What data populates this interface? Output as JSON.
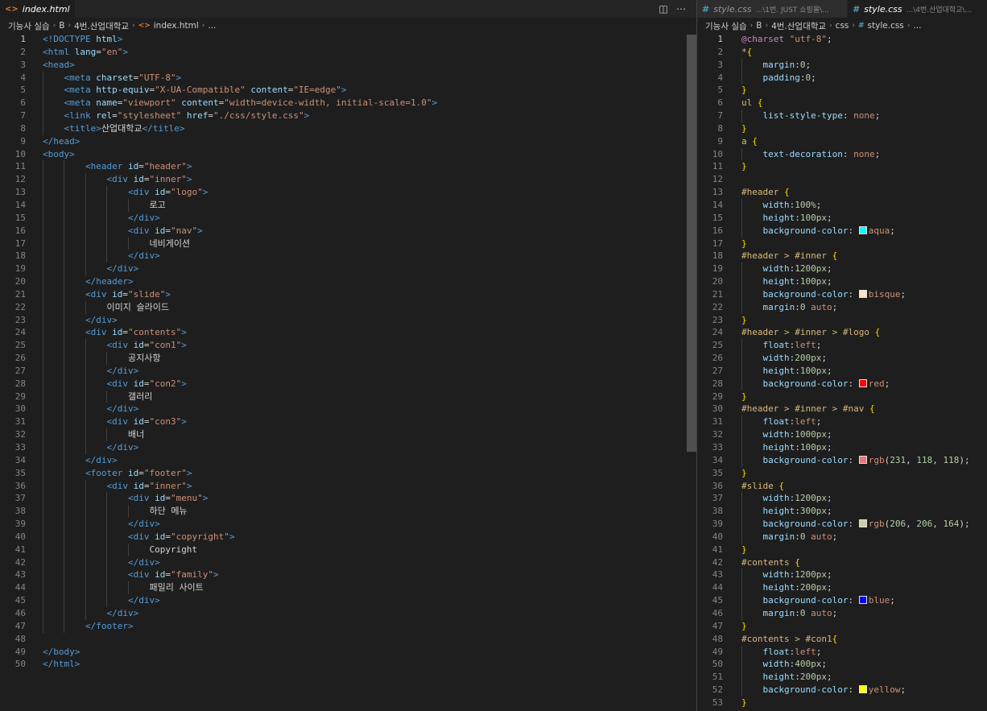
{
  "editor_left": {
    "tab": {
      "icon": "html-file-icon",
      "name": "index.html"
    },
    "breadcrumb": [
      "기능사 실습",
      "B",
      "4번.산업대학교",
      "index.html",
      "..."
    ],
    "lines": [
      [
        "<!DOCTYPE html>"
      ],
      [
        "<html lang=\"en\">"
      ],
      [
        "<head>"
      ],
      [
        "    <meta charset=\"UTF-8\">"
      ],
      [
        "    <meta http-equiv=\"X-UA-Compatible\" content=\"IE=edge\">"
      ],
      [
        "    <meta name=\"viewport\" content=\"width=device-width, initial-scale=1.0\">"
      ],
      [
        "    <link rel=\"stylesheet\" href=\"./css/style.css\">"
      ],
      [
        "    <title>산업대학교</title>"
      ],
      [
        "</head>"
      ],
      [
        "<body>"
      ],
      [
        "        <header id=\"header\">"
      ],
      [
        "            <div id=\"inner\">"
      ],
      [
        "                <div id=\"logo\">"
      ],
      [
        "                    로고"
      ],
      [
        "                </div>"
      ],
      [
        "                <div id=\"nav\">"
      ],
      [
        "                    네비게이션"
      ],
      [
        "                </div>"
      ],
      [
        "            </div>"
      ],
      [
        "        </header>"
      ],
      [
        "        <div id=\"slide\">"
      ],
      [
        "            이미지 슬라이드"
      ],
      [
        "        </div>"
      ],
      [
        "        <div id=\"contents\">"
      ],
      [
        "            <div id=\"con1\">"
      ],
      [
        "                공지사항"
      ],
      [
        "            </div>"
      ],
      [
        "            <div id=\"con2\">"
      ],
      [
        "                갤러리"
      ],
      [
        "            </div>"
      ],
      [
        "            <div id=\"con3\">"
      ],
      [
        "                배너"
      ],
      [
        "            </div>"
      ],
      [
        "        </div>"
      ],
      [
        "        <footer id=\"footer\">"
      ],
      [
        "            <div id=\"inner\">"
      ],
      [
        "                <div id=\"menu\">"
      ],
      [
        "                    하단 메뉴"
      ],
      [
        "                </div>"
      ],
      [
        "                <div id=\"copyright\">"
      ],
      [
        "                    Copyright"
      ],
      [
        "                </div>"
      ],
      [
        "                <div id=\"family\">"
      ],
      [
        "                    패밀리 사이트"
      ],
      [
        "                </div>"
      ],
      [
        "            </div>"
      ],
      [
        "        </footer>"
      ],
      [
        ""
      ],
      [
        "</body>"
      ],
      [
        "</html>"
      ]
    ]
  },
  "editor_right": {
    "tabs": [
      {
        "icon": "css-file-icon",
        "name": "style.css",
        "desc": "...\\1번. JUST 쇼핑몰\\..."
      },
      {
        "icon": "css-file-icon",
        "name": "style.css",
        "desc": "...\\4번.산업대학교\\..."
      }
    ],
    "breadcrumb": [
      "기능사 실습",
      "B",
      "4번.산업대학교",
      "css",
      "style.css",
      "..."
    ],
    "lines": [
      "@charset \"utf-8\";",
      "*{",
      "    margin:0;",
      "    padding:0;",
      "}",
      "ul {",
      "    list-style-type: none;",
      "}",
      "a {",
      "    text-decoration: none;",
      "}",
      "",
      "#header {",
      "    width:100%;",
      "    height:100px;",
      "    background-color: aqua;",
      "}",
      "#header > #inner {",
      "    width:1200px;",
      "    height:100px;",
      "    background-color: bisque;",
      "    margin:0 auto;",
      "}",
      "#header > #inner > #logo {",
      "    float:left;",
      "    width:200px;",
      "    height:100px;",
      "    background-color: red;",
      "}",
      "#header > #inner > #nav {",
      "    float:left;",
      "    width:1000px;",
      "    height:100px;",
      "    background-color: rgb(231, 118, 118);",
      "}",
      "#slide {",
      "    width:1200px;",
      "    height:300px;",
      "    background-color: rgb(206, 206, 164);",
      "    margin:0 auto;",
      "}",
      "#contents {",
      "    width:1200px;",
      "    height:200px;",
      "    background-color: blue;",
      "    margin:0 auto;",
      "}",
      "#contents > #con1{",
      "    float:left;",
      "    width:400px;",
      "    height:200px;",
      "    background-color: yellow;",
      "}"
    ],
    "swatches": {
      "aqua": "#00ffff",
      "bisque": "#ffe4c4",
      "red": "#ff0000",
      "rgb(231, 118, 118)": "#e77676",
      "rgb(206, 206, 164)": "#cecea4",
      "blue": "#0000ff",
      "yellow": "#ffff00"
    }
  },
  "colors": {
    "background": "#1e1e1e",
    "tag": "#569cd6",
    "attr": "#9cdcfe",
    "string": "#ce9178",
    "selector": "#d7ba7d"
  }
}
